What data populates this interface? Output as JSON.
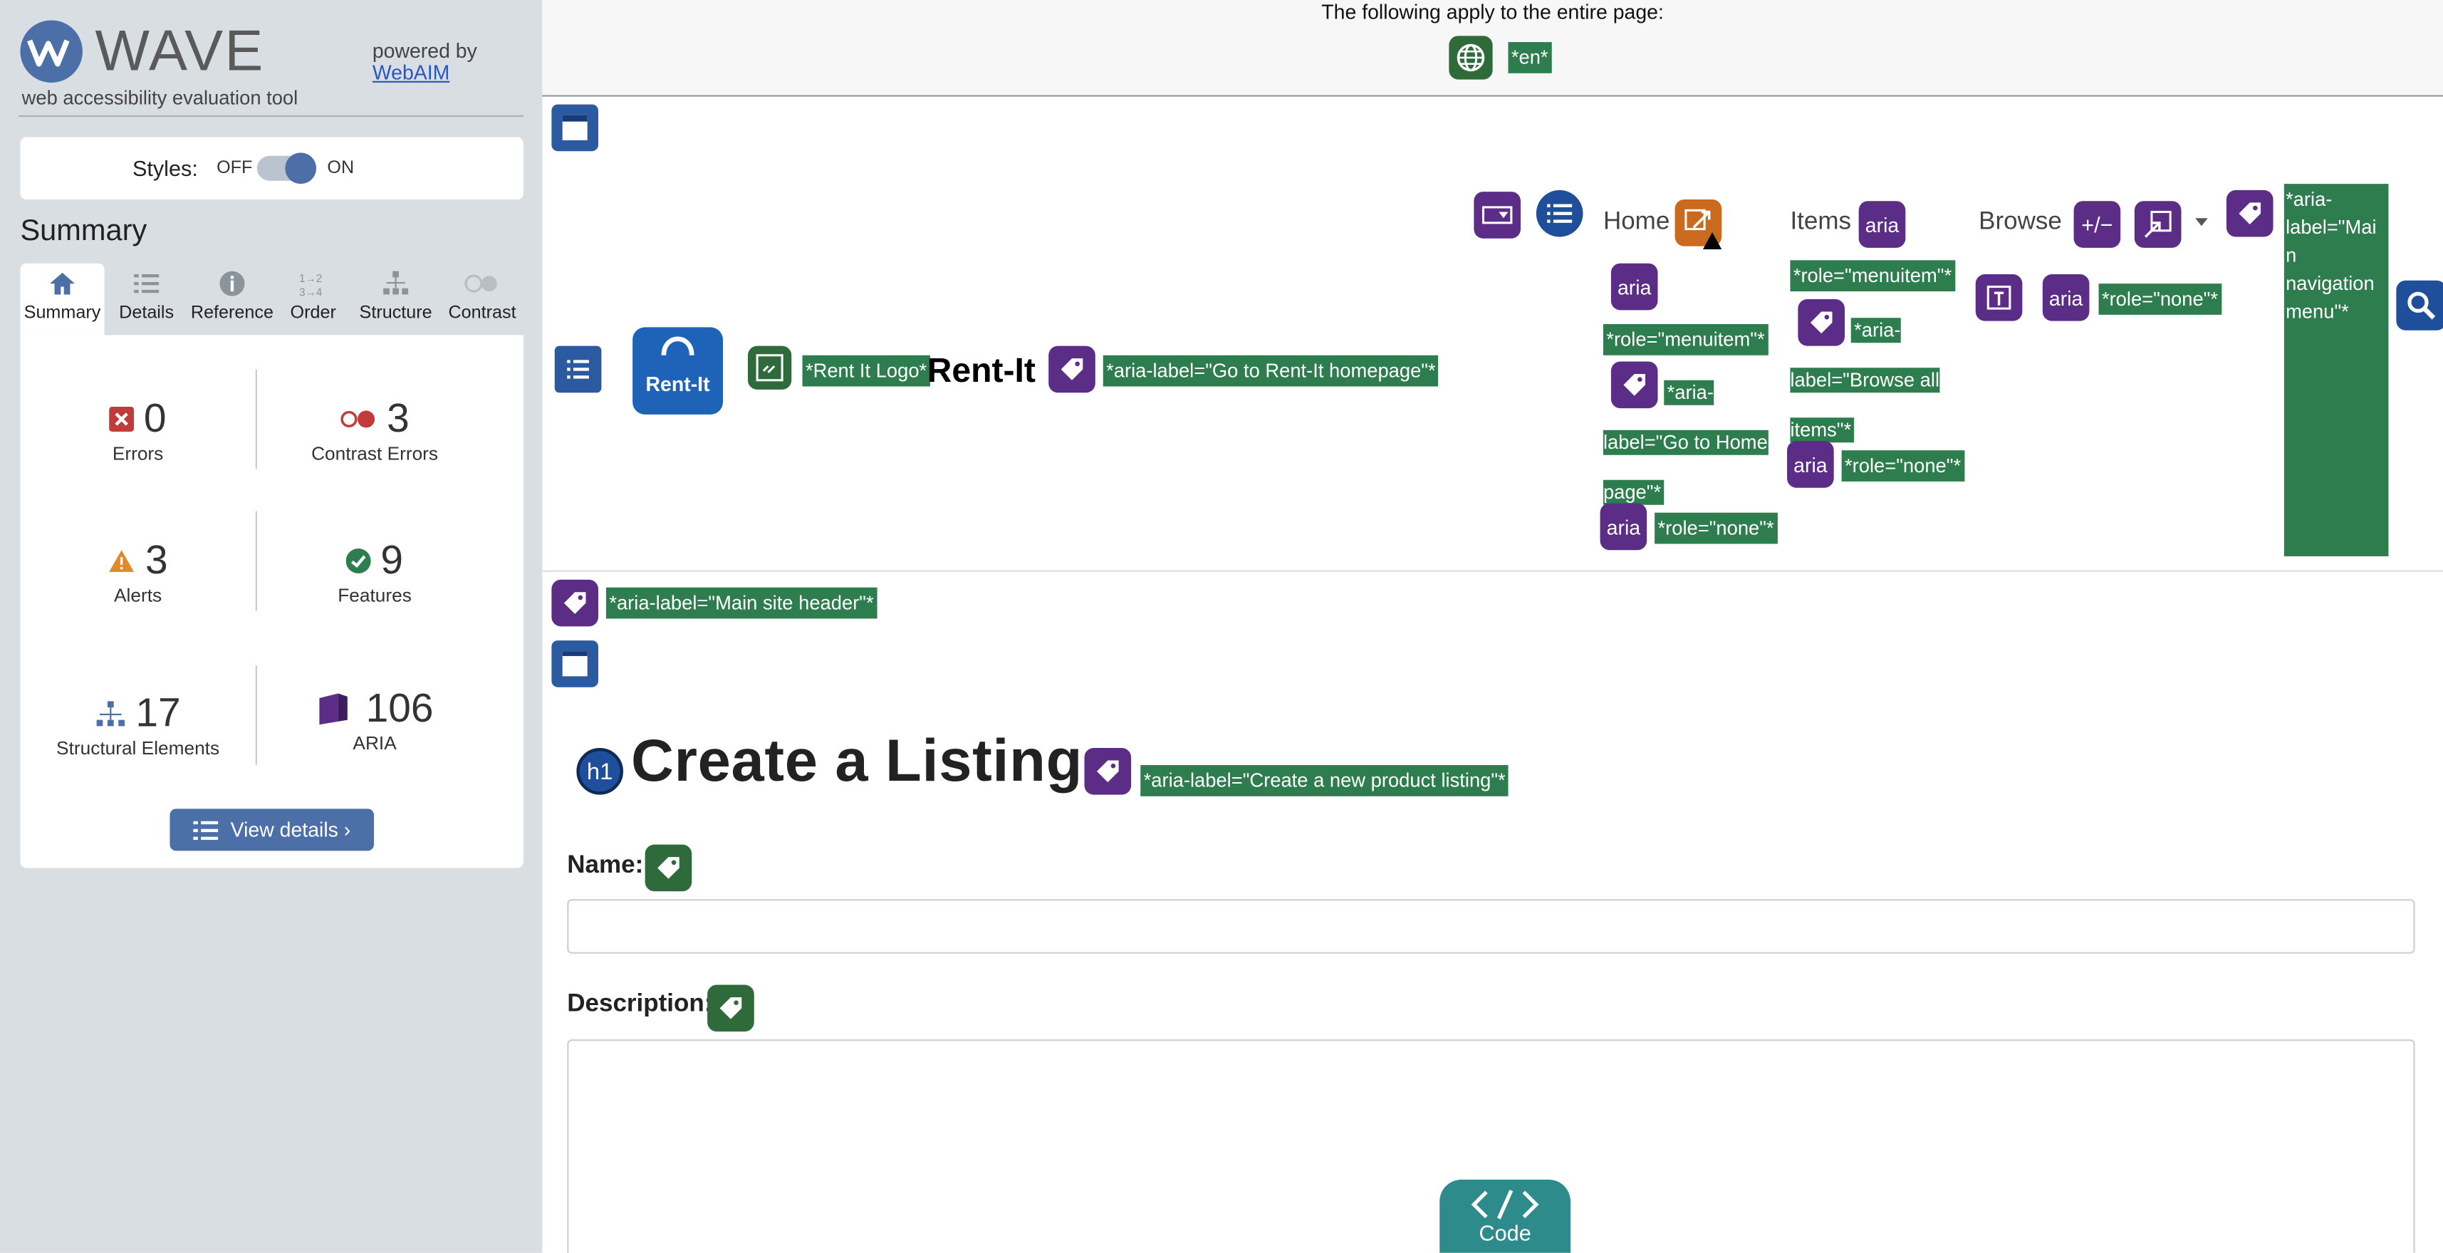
{
  "wave": {
    "logo_text": "WAVE",
    "tagline": "web accessibility evaluation tool",
    "powered_by": "powered by",
    "webaim_link": "WebAIM",
    "styles_label": "Styles:",
    "styles_off": "OFF",
    "styles_on": "ON",
    "summary_heading": "Summary",
    "tabs": [
      {
        "label": "Summary",
        "icon": "home-icon"
      },
      {
        "label": "Details",
        "icon": "list-icon"
      },
      {
        "label": "Reference",
        "icon": "info-icon"
      },
      {
        "label": "Order",
        "icon": "order-icon"
      },
      {
        "label": "Structure",
        "icon": "structure-icon"
      },
      {
        "label": "Contrast",
        "icon": "contrast-icon"
      }
    ],
    "stats": {
      "errors": {
        "value": "0",
        "label": "Errors"
      },
      "contrast_errors": {
        "value": "3",
        "label": "Contrast Errors"
      },
      "alerts": {
        "value": "3",
        "label": "Alerts"
      },
      "features": {
        "value": "9",
        "label": "Features"
      },
      "structural": {
        "value": "17",
        "label": "Structural Elements"
      },
      "aria": {
        "value": "106",
        "label": "ARIA"
      }
    },
    "view_details": "View details ›",
    "colors": {
      "accent": "#4d6fa8",
      "error": "#c23b3b",
      "alert": "#e08a2c",
      "feature": "#2e7d4f",
      "aria": "#5b2d86"
    }
  },
  "page": {
    "applies_text": "The following apply to the entire page:",
    "lang_tag": "*en*",
    "logo_alt_tag": "*Rent It Logo*",
    "logo_badge": "Rent-It",
    "site_name": "Rent-It",
    "homepage_label_tag": "*aria-label=\"Go to Rent-It homepage\"*",
    "nav": {
      "home": "Home",
      "items": "Items",
      "browse": "Browse",
      "aria_icon": "aria",
      "plusminus": "+/−",
      "role_menuitem": "*role=\"menuitem\"*",
      "role_menuitem2": "*role=\"menuitem\"*",
      "home_label_tag": "*aria-label=\"Go to Home page\"*",
      "browse_label_tag": "*aria-label=\"Browse all items\"*",
      "role_none_1": "*role=\"none\"*",
      "role_none_2": "*role=\"none\"*",
      "role_none_3": "*role=\"none\"*",
      "main_nav_tag": "*aria-label=\"Main navigation menu\"*"
    },
    "site_header_tag": "*aria-label=\"Main site header\"*",
    "h1_badge": "h1",
    "title": "Create a Listing",
    "title_tag": "*aria-label=\"Create a new product listing\"*",
    "name_label": "Name:",
    "name_value": "",
    "description_label": "Description:",
    "description_value": "",
    "code_button": "Code"
  }
}
